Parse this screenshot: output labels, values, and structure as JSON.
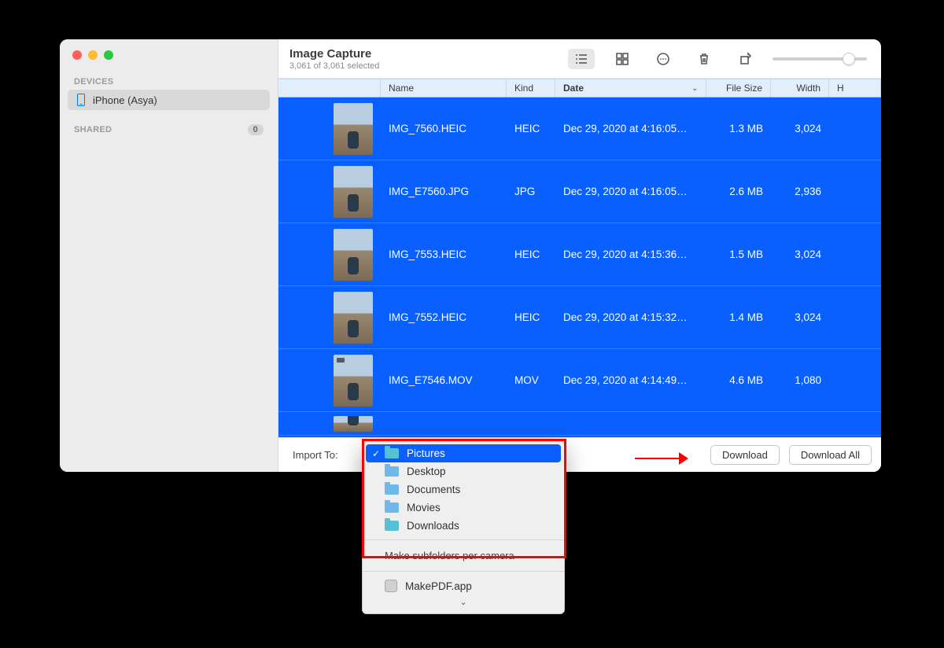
{
  "app": {
    "title": "Image Capture",
    "subtitle": "3,061 of 3,061 selected"
  },
  "sidebar": {
    "section_devices": "DEVICES",
    "section_shared": "SHARED",
    "shared_count": "0",
    "device": "iPhone (Asya)"
  },
  "columns": {
    "name": "Name",
    "kind": "Kind",
    "date": "Date",
    "size": "File Size",
    "width": "Width",
    "h": "H"
  },
  "rows": [
    {
      "name": "IMG_7560.HEIC",
      "kind": "HEIC",
      "date": "Dec 29, 2020 at 4:16:05…",
      "size": "1.3 MB",
      "width": "3,024"
    },
    {
      "name": "IMG_E7560.JPG",
      "kind": "JPG",
      "date": "Dec 29, 2020 at 4:16:05…",
      "size": "2.6 MB",
      "width": "2,936"
    },
    {
      "name": "IMG_7553.HEIC",
      "kind": "HEIC",
      "date": "Dec 29, 2020 at 4:15:36…",
      "size": "1.5 MB",
      "width": "3,024"
    },
    {
      "name": "IMG_7552.HEIC",
      "kind": "HEIC",
      "date": "Dec 29, 2020 at 4:15:32…",
      "size": "1.4 MB",
      "width": "3,024"
    },
    {
      "name": "IMG_E7546.MOV",
      "kind": "MOV",
      "date": "Dec 29, 2020 at 4:14:49…",
      "size": "4.6 MB",
      "width": "1,080"
    }
  ],
  "bottom": {
    "import_to_label": "Import To:",
    "download": "Download",
    "download_all": "Download All"
  },
  "dropdown": {
    "items": [
      "Pictures",
      "Desktop",
      "Documents",
      "Movies",
      "Downloads"
    ],
    "subfolders": "Make subfolders per camera",
    "app": "MakePDF.app"
  }
}
